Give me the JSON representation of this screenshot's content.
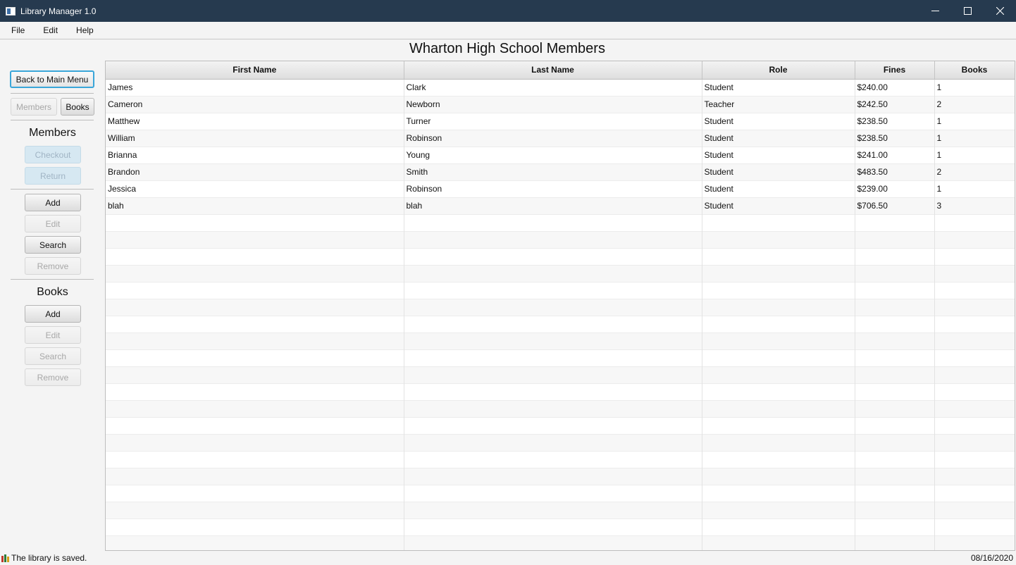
{
  "window": {
    "title": "Library Manager 1.0"
  },
  "menu": [
    "File",
    "Edit",
    "Help"
  ],
  "sidebar": {
    "back_label": "Back to Main Menu",
    "tabs": {
      "members": "Members",
      "books": "Books"
    },
    "members_section": {
      "heading": "Members",
      "checkout": "Checkout",
      "return": "Return",
      "add": "Add",
      "edit": "Edit",
      "search": "Search",
      "remove": "Remove"
    },
    "books_section": {
      "heading": "Books",
      "add": "Add",
      "edit": "Edit",
      "search": "Search",
      "remove": "Remove"
    }
  },
  "main": {
    "title": "Wharton High School Members",
    "columns": [
      "First Name",
      "Last Name",
      "Role",
      "Fines",
      "Books"
    ],
    "rows": [
      [
        "James",
        "Clark",
        "Student",
        "$240.00",
        "1"
      ],
      [
        "Cameron",
        "Newborn",
        "Teacher",
        "$242.50",
        "2"
      ],
      [
        "Matthew",
        "Turner",
        "Student",
        "$238.50",
        "1"
      ],
      [
        "William",
        "Robinson",
        "Student",
        "$238.50",
        "1"
      ],
      [
        "Brianna",
        "Young",
        "Student",
        "$241.00",
        "1"
      ],
      [
        "Brandon",
        "Smith",
        "Student",
        "$483.50",
        "2"
      ],
      [
        "Jessica",
        "Robinson",
        "Student",
        "$239.00",
        "1"
      ],
      [
        "blah",
        "blah",
        "Student",
        "$706.50",
        "3"
      ]
    ]
  },
  "status": {
    "message": "The library is saved.",
    "date": "08/16/2020"
  },
  "colors": {
    "titlebar": "#263a4f",
    "focus_ring": "#3aa6d9"
  }
}
